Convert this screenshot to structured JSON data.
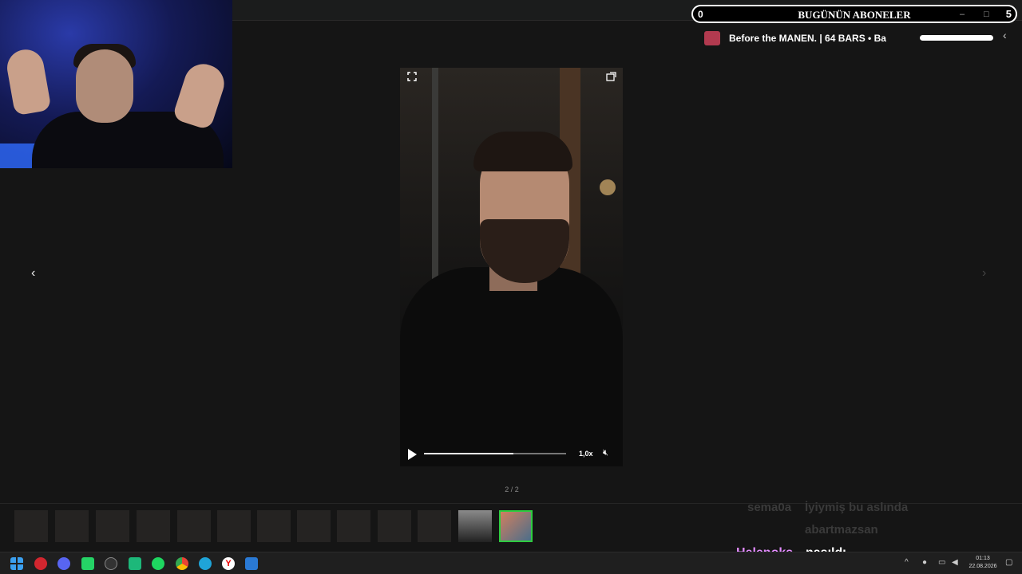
{
  "stream_overlay": {
    "subs_count": "0",
    "subs_title": "BUGÜNÜN ABONELER",
    "subs_goal": "5",
    "ticker_text": "Before the MANEN. | 64 BARS  •  Ba"
  },
  "viewer": {
    "counter": "2 / 2",
    "video": {
      "speed_label": "1,0x",
      "progress": 0.63
    }
  },
  "chat": [
    {
      "user": "sema0a",
      "message": "İyiymiş bu aslında"
    },
    {
      "user": "",
      "message": "abartmazsan"
    },
    {
      "user": "Helenoks",
      "message": "nasıldı"
    }
  ],
  "taskbar": {
    "time": "01:13",
    "date": "22.08.2026"
  }
}
